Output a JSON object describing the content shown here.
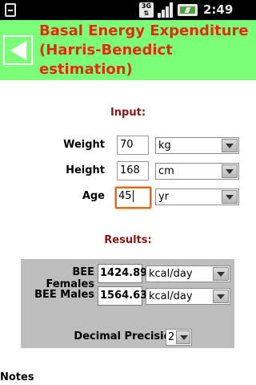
{
  "status_bar": {
    "time": "2:49 PM",
    "network_label": "3G",
    "icons": [
      "sd-card-icon",
      "3g-icon",
      "signal-icon",
      "battery-icon"
    ]
  },
  "header": {
    "title": "Basal Energy Expenditure (Harris-Benedict estimation)",
    "back_icon": "back-arrow-icon",
    "colors": {
      "background": "#7cff78",
      "title": "#e8290f"
    }
  },
  "input_section": {
    "heading": "Input:",
    "fields": [
      {
        "label": "Weight",
        "value": "70",
        "unit": "kg"
      },
      {
        "label": "Height",
        "value": "168",
        "unit": "cm"
      },
      {
        "label": "Age",
        "value": "45",
        "unit": "yr"
      }
    ]
  },
  "results_section": {
    "heading": "Results:",
    "rows": [
      {
        "label": "BEE Females",
        "value": "1424.89",
        "unit": "kcal/day"
      },
      {
        "label": "BEE Males",
        "value": "1564.63",
        "unit": "kcal/day"
      }
    ],
    "precision_label": "Decimal Precision:",
    "precision_value": "2"
  },
  "notes_heading": "Notes"
}
